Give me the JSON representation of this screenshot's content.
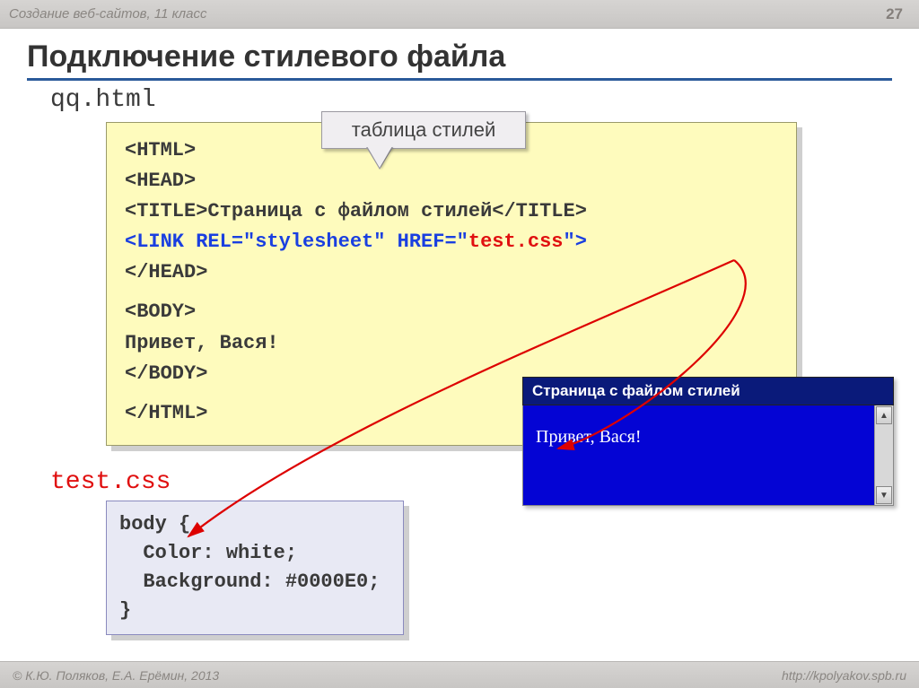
{
  "header": {
    "course": "Создание веб-сайтов, 11 класс",
    "page_number": "27"
  },
  "title": "Подключение стилевого файла",
  "filename_html": "qq.html",
  "callout": "таблица стилей",
  "code": {
    "l1": "<HTML>",
    "l2": "<HEAD>",
    "l3a": "<TITLE>",
    "l3b": "Страница с файлом стилей",
    "l3c": "</TITLE>",
    "l4a": "<LINK REL=\"stylesheet\" HREF=\"",
    "l4b": "test.css",
    "l4c": "\">",
    "l5": "</HEAD>",
    "l6": "<BODY>",
    "l7": "Привет, Вася!",
    "l8": "</BODY>",
    "l9": "</HTML>"
  },
  "filename_css": "test.css",
  "css": {
    "l1": "body {",
    "l2": "  Color: white;",
    "l3": "  Background: #0000E0;",
    "l4": "}"
  },
  "browser": {
    "title": "Страница с файлом стилей",
    "content": "Привет, Вася!"
  },
  "footer": {
    "left": "© К.Ю. Поляков, Е.А. Ерёмин, 2013",
    "right": "http://kpolyakov.spb.ru"
  }
}
